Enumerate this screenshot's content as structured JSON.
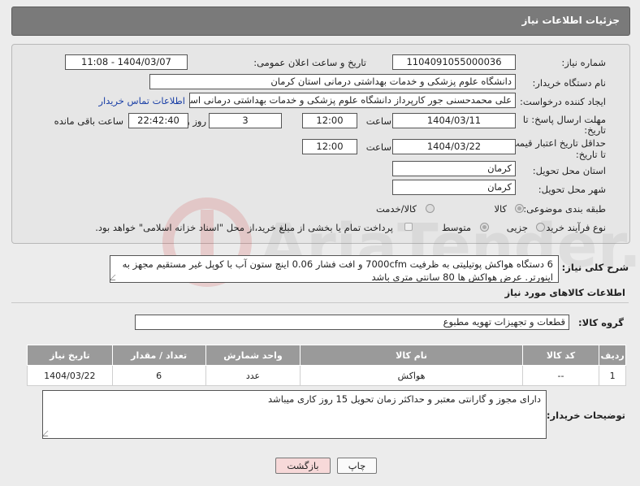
{
  "header": {
    "title": "جزئیات اطلاعات نیاز"
  },
  "form": {
    "need_number": {
      "label": "شماره نیاز:",
      "value": "1104091055000036"
    },
    "announce_date": {
      "label": "تاریخ و ساعت اعلان عمومی:",
      "value": "1404/03/07 - 11:08"
    },
    "buyer_org": {
      "label": "نام دستگاه خریدار:",
      "value": "دانشگاه علوم پزشکی و خدمات بهداشتی درمانی استان کرمان"
    },
    "requester": {
      "label": "ایجاد کننده درخواست:",
      "value": "علی محمدحسنی جور کارپرداز دانشگاه علوم پزشکی و خدمات بهداشتی درمانی استان کرمان",
      "contact_link": "اطلاعات تماس خریدار"
    },
    "reply_deadline": {
      "label_line1": "مهلت ارسال پاسخ: تا",
      "label_line2": "تاریخ:",
      "date": "1404/03/11",
      "time_label": "ساعت",
      "time": "12:00",
      "days": "3",
      "days_label": "روز و",
      "remaining": "22:42:40",
      "remaining_label": "ساعت باقی مانده"
    },
    "price_validity": {
      "label_line1": "حداقل تاریخ اعتبار قیمت:",
      "label_line2": "تا تاریخ:",
      "date": "1404/03/22",
      "time_label": "ساعت",
      "time": "12:00"
    },
    "delivery_province": {
      "label": "استان محل تحویل:",
      "value": "کرمان"
    },
    "delivery_city": {
      "label": "شهر محل تحویل:",
      "value": "کرمان"
    },
    "category": {
      "label": "طبقه بندی موضوعی:",
      "options": [
        "کالا",
        "کالا/خدمت"
      ],
      "selected": "کالا"
    },
    "purchase_process": {
      "label": "نوع فرآیند خرید :",
      "options": [
        "جزیی",
        "متوسط"
      ],
      "selected": "متوسط",
      "note": "پرداخت تمام یا بخشی از مبلغ خرید،از محل \"اسناد خزانه اسلامی\" خواهد بود."
    }
  },
  "description": {
    "label": "شرح کلی نیاز:",
    "text": "6 دستگاه هواکش پوتیلیتی به ظرفیت 7000cfm و افت فشار 0.06 اینچ ستون آب با کوپل غیر مستقیم مجهز به اینورتر. عرض هواکش ها 80 سانتی متری باشد"
  },
  "goods": {
    "section_title": "اطلاعات کالاهای مورد نیاز",
    "group_label": "گروه کالا:",
    "group_value": "قطعات و تجهیزات تهویه مطبوع",
    "columns": [
      "ردیف",
      "کد کالا",
      "نام کالا",
      "واحد شمارش",
      "تعداد / مقدار",
      "تاریخ نیاز"
    ],
    "rows": [
      [
        "1",
        "--",
        "هواکش",
        "عدد",
        "6",
        "1404/03/22"
      ]
    ]
  },
  "buyer_notes": {
    "label": "توضیحات خریدار:",
    "text": "دارای مجوز و گارانتی معتبر و حداکثر زمان تحویل 15 روز کاری میباشد"
  },
  "buttons": {
    "print": "چاپ",
    "back": "بازگشت"
  },
  "watermark": {
    "brand": "AriaTender.neT"
  }
}
